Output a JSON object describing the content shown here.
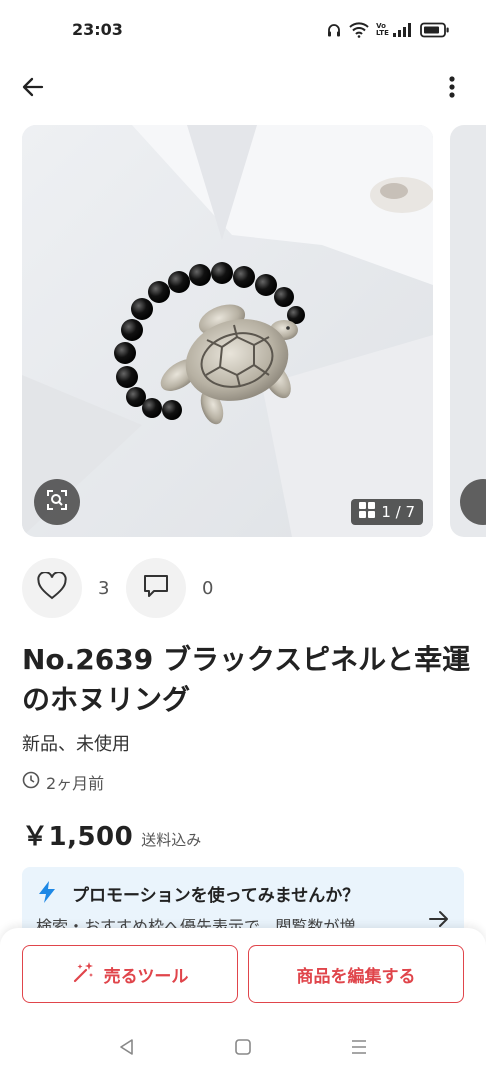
{
  "status_bar": {
    "time": "23:03",
    "volte_label": "Vo\nLTE"
  },
  "top_bar": {
    "back_icon": "arrow-left-icon",
    "more_icon": "more-vertical-icon"
  },
  "gallery": {
    "counter_text": "1 / 7",
    "grid_icon": "grid-icon",
    "lens_icon": "image-search-icon"
  },
  "reactions": {
    "likes": "3",
    "comments": "0"
  },
  "item": {
    "title": "No.2639 ブラックスピネルと幸運のホヌリング",
    "condition": "新品、未使用",
    "posted": "2ヶ月前",
    "price": "￥1,500",
    "shipping": "送料込み"
  },
  "promo": {
    "title": "プロモーションを使ってみませんか？",
    "description": "検索・おすすめ枠へ優先表示で、閲覧数が増",
    "bolt_color": "#1e88e5"
  },
  "actions": {
    "sell_tools": "売るツール",
    "edit_item": "商品を編集する",
    "accent": "#e0454b"
  },
  "nav": {
    "back": "nav-back-icon",
    "home": "nav-home-icon",
    "recents": "nav-menu-icon"
  }
}
